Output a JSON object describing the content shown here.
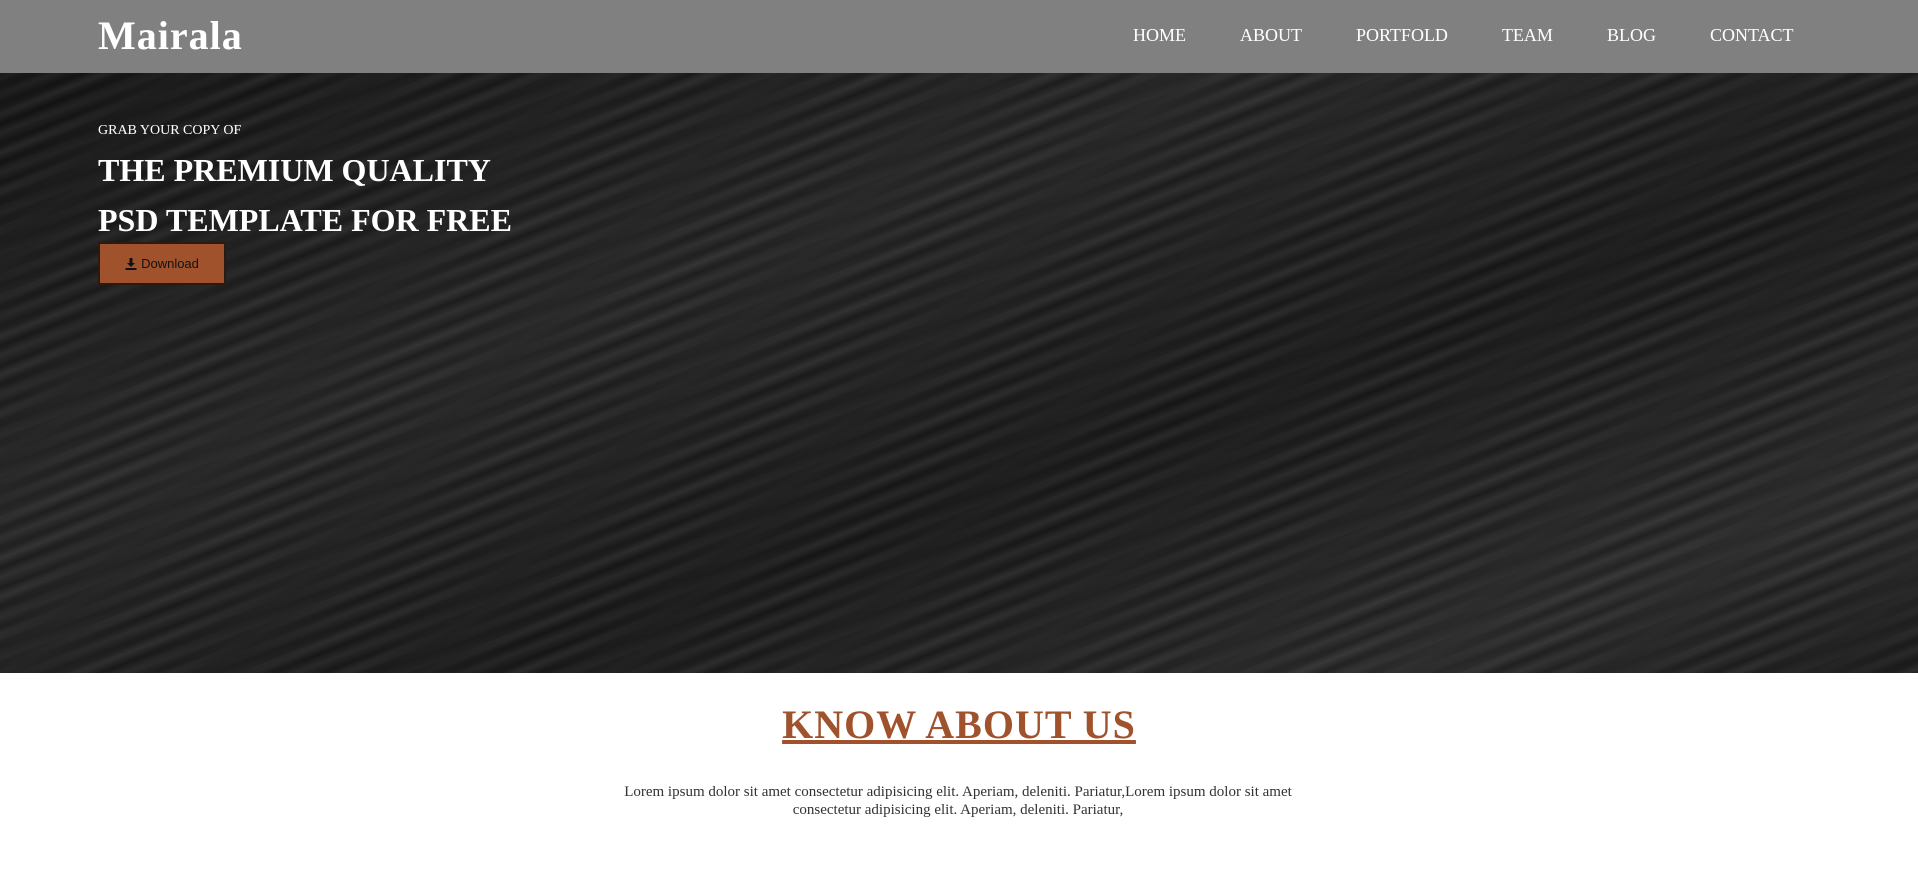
{
  "navbar": {
    "brand": "Mairala",
    "items": [
      {
        "label": "HOME"
      },
      {
        "label": "ABOUT"
      },
      {
        "label": "PORTFOLD"
      },
      {
        "label": "TEAM"
      },
      {
        "label": "BLOG"
      },
      {
        "label": "CONTACT"
      }
    ]
  },
  "hero": {
    "eyebrow": "GRAB YOUR COPY OF",
    "title_line1": "THE PREMIUM QUALITY",
    "title_line2": "PSD TEMPLATE FOR FREE",
    "download_label": "Download",
    "download_icon": "download-icon"
  },
  "about": {
    "title": "KNOW ABOUT US",
    "text": "Lorem ipsum dolor sit amet consectetur adipisicing elit. Aperiam, deleniti. Pariatur,Lorem ipsum dolor sit amet consectetur adipisicing elit. Aperiam, deleniti. Pariatur,"
  },
  "colors": {
    "navbar_bg": "#808080",
    "accent": "#a0522d",
    "hero_bg": "#1e1e1e"
  }
}
